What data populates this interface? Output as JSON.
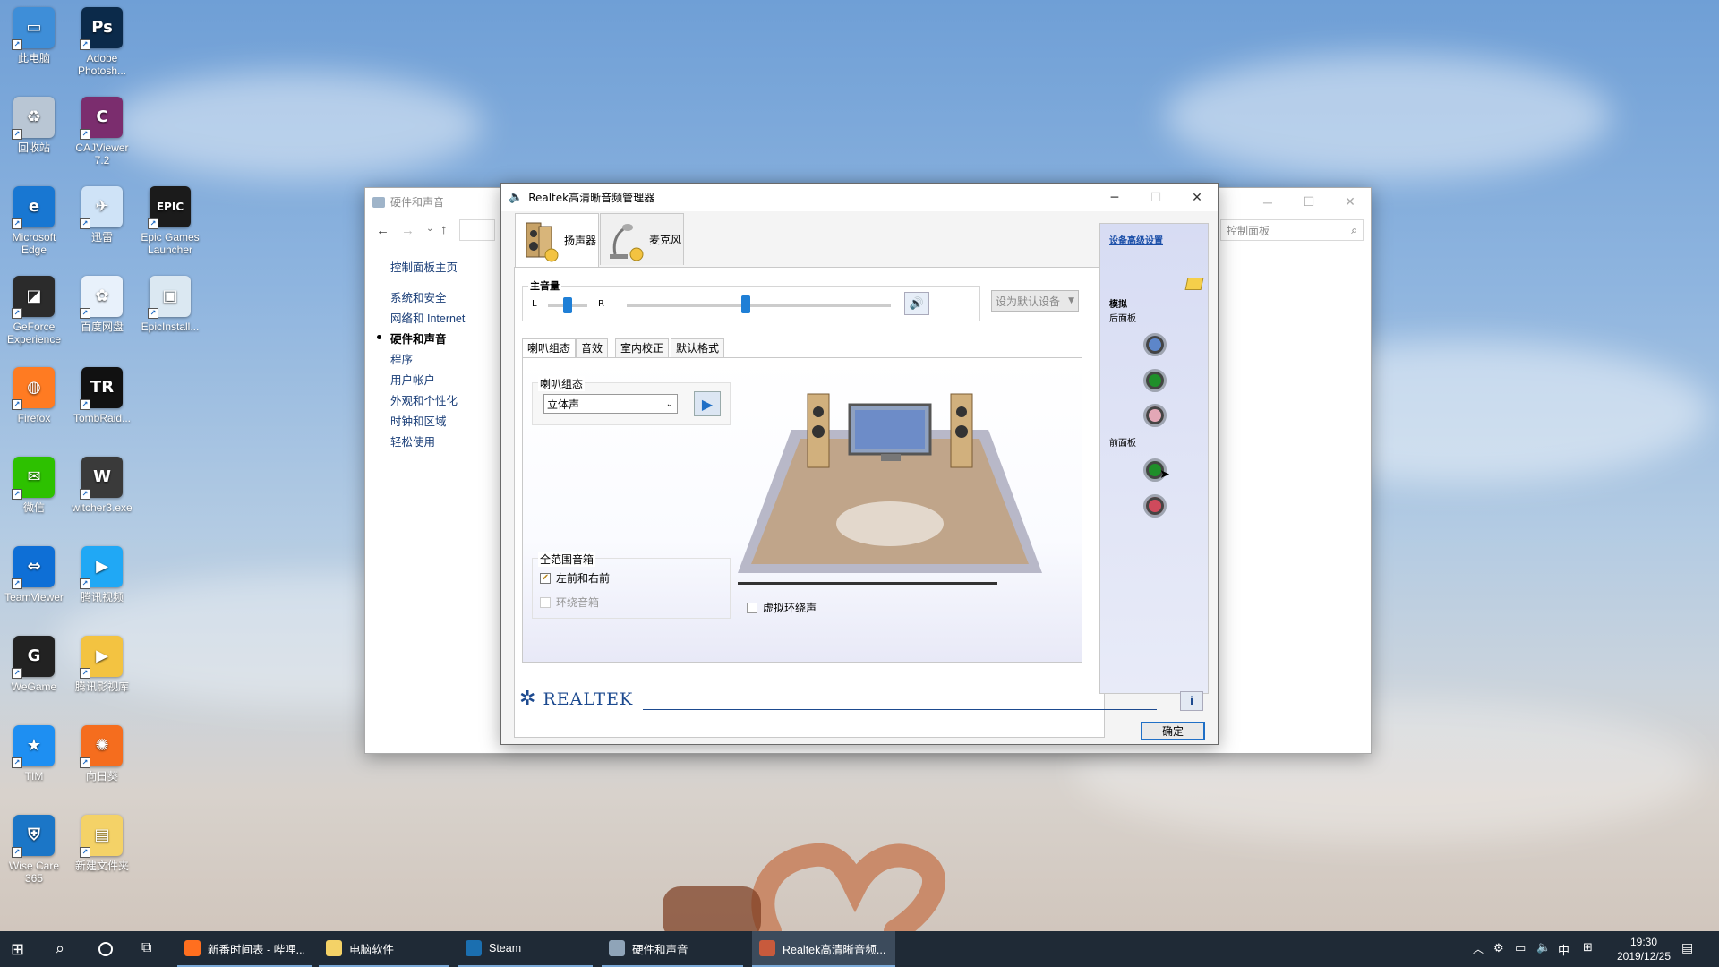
{
  "desktop": {
    "icons": [
      {
        "label": "此电脑",
        "color": "#3e8ed8",
        "glyph": "▭"
      },
      {
        "label": "Adobe Photosh...",
        "color": "#0b2a4a",
        "glyph": "Ps"
      },
      {
        "label": "回收站",
        "color": "#b9c6d4",
        "glyph": "♻"
      },
      {
        "label": "CAJViewer 7.2",
        "color": "#7b2d6e",
        "glyph": "C"
      },
      {
        "label": "Microsoft Edge",
        "color": "#1877d2",
        "glyph": "e"
      },
      {
        "label": "迅雷",
        "color": "#cfe3f7",
        "glyph": "✈"
      },
      {
        "label": "Epic Games Launcher",
        "color": "#1b1b1b",
        "glyph": "EPIC"
      },
      {
        "label": "GeForce Experience",
        "color": "#2b2b2b",
        "glyph": "◪"
      },
      {
        "label": "百度网盘",
        "color": "#e8f1fb",
        "glyph": "✿"
      },
      {
        "label": "EpicInstall...",
        "color": "#dbe8f2",
        "glyph": "▣"
      },
      {
        "label": "Firefox",
        "color": "#ff7b22",
        "glyph": "◍"
      },
      {
        "label": "TombRaid...",
        "color": "#111",
        "glyph": "TR"
      },
      {
        "label": "微信",
        "color": "#2dc100",
        "glyph": "✉"
      },
      {
        "label": "witcher3.exe",
        "color": "#3a3a3a",
        "glyph": "W"
      },
      {
        "label": "TeamViewer",
        "color": "#0e6fd6",
        "glyph": "⇔"
      },
      {
        "label": "腾讯视频",
        "color": "#20a8f5",
        "glyph": "▶"
      },
      {
        "label": "WeGame",
        "color": "#222",
        "glyph": "G"
      },
      {
        "label": "腾讯影视库",
        "color": "#f3c341",
        "glyph": "▶"
      },
      {
        "label": "TIM",
        "color": "#1e8ff2",
        "glyph": "★"
      },
      {
        "label": "向日葵",
        "color": "#f56d1e",
        "glyph": "✺"
      },
      {
        "label": "Wise Care 365",
        "color": "#1b76c7",
        "glyph": "⛨"
      },
      {
        "label": "新建文件夹",
        "color": "#f4d267",
        "glyph": "▤"
      }
    ]
  },
  "control_panel": {
    "title": "硬件和声音",
    "search_placeholder": "控制面板",
    "nav": {
      "back": "←",
      "forward": "→",
      "up": "↑"
    },
    "links": [
      "控制面板主页",
      "系统和安全",
      "网络和 Internet",
      "硬件和声音",
      "程序",
      "用户帐户",
      "外观和个性化",
      "时钟和区域",
      "轻松使用"
    ],
    "active_link": "硬件和声音"
  },
  "realtek": {
    "title": "Realtek高清晰音频管理器",
    "tabs": [
      "扬声器",
      "麦克风"
    ],
    "active_tab": "扬声器",
    "master_volume_label": "主音量",
    "balance_left": "L",
    "balance_right": "R",
    "balance_level": 0.5,
    "volume_level": 0.45,
    "set_default_label": "设为默认设备",
    "subtabs": [
      "喇叭组态",
      "音效",
      "室内校正",
      "默认格式"
    ],
    "active_subtab": "喇叭组态",
    "speaker_config_label": "喇叭组态",
    "speaker_config_value": "立体声",
    "fullrange_label": "全范围音箱",
    "front_lr_label": "左前和右前",
    "front_lr_checked": true,
    "surround_label": "环绕音箱",
    "surround_checked": false,
    "virtual_surround_label": "虚拟环绕声",
    "virtual_surround_checked": false,
    "advanced_link": "设备高级设置",
    "analog_label": "模拟",
    "rear_panel_label": "后面板",
    "front_panel_label": "前面板",
    "rear_jacks": [
      "#5d86c9",
      "#1f8f2a",
      "#e3a7b6"
    ],
    "front_jacks": [
      "#1f8f2a",
      "#cf4a5c"
    ],
    "brand": "REALTEK",
    "ok_label": "确定"
  },
  "taskbar": {
    "items": [
      {
        "label": "新番时间表 - 哔哩...",
        "color": "#ff6f1f"
      },
      {
        "label": "电脑软件",
        "color": "#f4d267"
      },
      {
        "label": "Steam",
        "color": "#1b6fb0"
      },
      {
        "label": "硬件和声音",
        "color": "#8fa4b8"
      },
      {
        "label": "Realtek高清晰音频...",
        "color": "#c85a3c"
      }
    ],
    "ime": "中",
    "time": "19:30",
    "date": "2019/12/25"
  }
}
